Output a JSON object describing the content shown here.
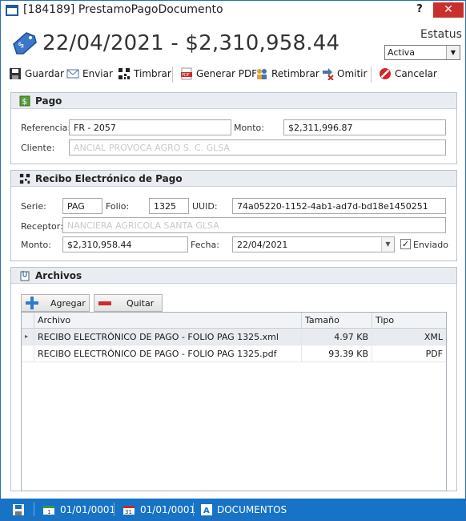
{
  "window": {
    "title": "[184189] PrestamoPagoDocumento",
    "help": "?",
    "close": "✕"
  },
  "header": {
    "title": "22/04/2021 - $2,310,958.44",
    "estatus_label": "Estatus",
    "estatus_value": "Activa"
  },
  "toolbar": {
    "guardar": "Guardar",
    "enviar": "Enviar",
    "timbrar": "Timbrar",
    "generar_pdf": "Generar PDF",
    "retimbrar": "Retimbrar",
    "omitir": "Omitir",
    "cancelar": "Cancelar"
  },
  "pago": {
    "title": "Pago",
    "referencia_label": "Referencia:",
    "referencia_value": "FR - 2057",
    "monto_label": "Monto:",
    "monto_value": "$2,311,996.87",
    "cliente_label": "Cliente:",
    "cliente_value": "ANCIAL PROVOCA AGRO S. C.   GLSA"
  },
  "recibo": {
    "title": "Recibo Electrónico de Pago",
    "serie_label": "Serie:",
    "serie_value": "PAG",
    "folio_label": "Folio:",
    "folio_value": "1325",
    "uuid_label": "UUID:",
    "uuid_value": "74a05220-1152-4ab1-ad7d-bd18e1450251",
    "receptor_label": "Receptor:",
    "receptor_value": "NANCIERA AGRICOLA SANTA          GLSA",
    "monto_label": "Monto:",
    "monto_value": "$2,310,958.44",
    "fecha_label": "Fecha:",
    "fecha_value": "22/04/2021",
    "enviado_label": "Enviado",
    "enviado_checked": "✓"
  },
  "archivos": {
    "title": "Archivos",
    "agregar": "Agregar",
    "quitar": "Quitar",
    "columns": {
      "archivo": "Archivo",
      "tamano": "Tamaño",
      "tipo": "Tipo"
    },
    "rows": [
      {
        "marker": "▸",
        "archivo": "RECIBO ELECTRÓNICO DE PAGO - FOLIO PAG 1325.xml",
        "tamano": "4.97 KB",
        "tipo": "XML"
      },
      {
        "marker": "",
        "archivo": "RECIBO ELECTRÓNICO DE PAGO - FOLIO PAG 1325.pdf",
        "tamano": "93.39 KB",
        "tipo": "PDF"
      }
    ]
  },
  "statusbar": {
    "date1": "01/01/0001",
    "date2": "01/01/0001",
    "section": "DOCUMENTOS"
  },
  "colors": {
    "accent": "#1673c6",
    "close": "#c9302c",
    "group_header": "#e9edf2"
  }
}
